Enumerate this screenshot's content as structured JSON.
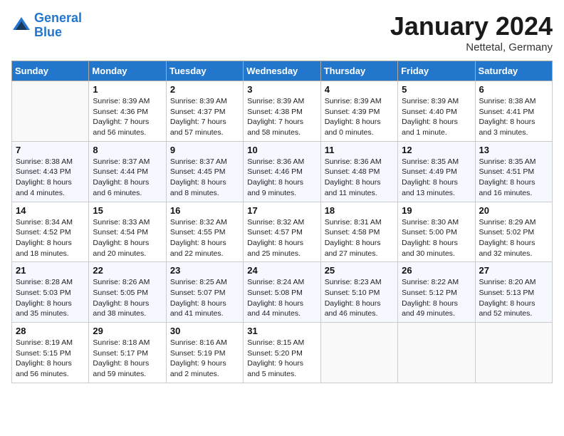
{
  "header": {
    "logo_line1": "General",
    "logo_line2": "Blue",
    "month_title": "January 2024",
    "subtitle": "Nettetal, Germany"
  },
  "weekdays": [
    "Sunday",
    "Monday",
    "Tuesday",
    "Wednesday",
    "Thursday",
    "Friday",
    "Saturday"
  ],
  "weeks": [
    {
      "days": [
        {
          "num": "",
          "info": ""
        },
        {
          "num": "1",
          "info": "Sunrise: 8:39 AM\nSunset: 4:36 PM\nDaylight: 7 hours\nand 56 minutes."
        },
        {
          "num": "2",
          "info": "Sunrise: 8:39 AM\nSunset: 4:37 PM\nDaylight: 7 hours\nand 57 minutes."
        },
        {
          "num": "3",
          "info": "Sunrise: 8:39 AM\nSunset: 4:38 PM\nDaylight: 7 hours\nand 58 minutes."
        },
        {
          "num": "4",
          "info": "Sunrise: 8:39 AM\nSunset: 4:39 PM\nDaylight: 8 hours\nand 0 minutes."
        },
        {
          "num": "5",
          "info": "Sunrise: 8:39 AM\nSunset: 4:40 PM\nDaylight: 8 hours\nand 1 minute."
        },
        {
          "num": "6",
          "info": "Sunrise: 8:38 AM\nSunset: 4:41 PM\nDaylight: 8 hours\nand 3 minutes."
        }
      ]
    },
    {
      "days": [
        {
          "num": "7",
          "info": "Sunrise: 8:38 AM\nSunset: 4:43 PM\nDaylight: 8 hours\nand 4 minutes."
        },
        {
          "num": "8",
          "info": "Sunrise: 8:37 AM\nSunset: 4:44 PM\nDaylight: 8 hours\nand 6 minutes."
        },
        {
          "num": "9",
          "info": "Sunrise: 8:37 AM\nSunset: 4:45 PM\nDaylight: 8 hours\nand 8 minutes."
        },
        {
          "num": "10",
          "info": "Sunrise: 8:36 AM\nSunset: 4:46 PM\nDaylight: 8 hours\nand 9 minutes."
        },
        {
          "num": "11",
          "info": "Sunrise: 8:36 AM\nSunset: 4:48 PM\nDaylight: 8 hours\nand 11 minutes."
        },
        {
          "num": "12",
          "info": "Sunrise: 8:35 AM\nSunset: 4:49 PM\nDaylight: 8 hours\nand 13 minutes."
        },
        {
          "num": "13",
          "info": "Sunrise: 8:35 AM\nSunset: 4:51 PM\nDaylight: 8 hours\nand 16 minutes."
        }
      ]
    },
    {
      "days": [
        {
          "num": "14",
          "info": "Sunrise: 8:34 AM\nSunset: 4:52 PM\nDaylight: 8 hours\nand 18 minutes."
        },
        {
          "num": "15",
          "info": "Sunrise: 8:33 AM\nSunset: 4:54 PM\nDaylight: 8 hours\nand 20 minutes."
        },
        {
          "num": "16",
          "info": "Sunrise: 8:32 AM\nSunset: 4:55 PM\nDaylight: 8 hours\nand 22 minutes."
        },
        {
          "num": "17",
          "info": "Sunrise: 8:32 AM\nSunset: 4:57 PM\nDaylight: 8 hours\nand 25 minutes."
        },
        {
          "num": "18",
          "info": "Sunrise: 8:31 AM\nSunset: 4:58 PM\nDaylight: 8 hours\nand 27 minutes."
        },
        {
          "num": "19",
          "info": "Sunrise: 8:30 AM\nSunset: 5:00 PM\nDaylight: 8 hours\nand 30 minutes."
        },
        {
          "num": "20",
          "info": "Sunrise: 8:29 AM\nSunset: 5:02 PM\nDaylight: 8 hours\nand 32 minutes."
        }
      ]
    },
    {
      "days": [
        {
          "num": "21",
          "info": "Sunrise: 8:28 AM\nSunset: 5:03 PM\nDaylight: 8 hours\nand 35 minutes."
        },
        {
          "num": "22",
          "info": "Sunrise: 8:26 AM\nSunset: 5:05 PM\nDaylight: 8 hours\nand 38 minutes."
        },
        {
          "num": "23",
          "info": "Sunrise: 8:25 AM\nSunset: 5:07 PM\nDaylight: 8 hours\nand 41 minutes."
        },
        {
          "num": "24",
          "info": "Sunrise: 8:24 AM\nSunset: 5:08 PM\nDaylight: 8 hours\nand 44 minutes."
        },
        {
          "num": "25",
          "info": "Sunrise: 8:23 AM\nSunset: 5:10 PM\nDaylight: 8 hours\nand 46 minutes."
        },
        {
          "num": "26",
          "info": "Sunrise: 8:22 AM\nSunset: 5:12 PM\nDaylight: 8 hours\nand 49 minutes."
        },
        {
          "num": "27",
          "info": "Sunrise: 8:20 AM\nSunset: 5:13 PM\nDaylight: 8 hours\nand 52 minutes."
        }
      ]
    },
    {
      "days": [
        {
          "num": "28",
          "info": "Sunrise: 8:19 AM\nSunset: 5:15 PM\nDaylight: 8 hours\nand 56 minutes."
        },
        {
          "num": "29",
          "info": "Sunrise: 8:18 AM\nSunset: 5:17 PM\nDaylight: 8 hours\nand 59 minutes."
        },
        {
          "num": "30",
          "info": "Sunrise: 8:16 AM\nSunset: 5:19 PM\nDaylight: 9 hours\nand 2 minutes."
        },
        {
          "num": "31",
          "info": "Sunrise: 8:15 AM\nSunset: 5:20 PM\nDaylight: 9 hours\nand 5 minutes."
        },
        {
          "num": "",
          "info": ""
        },
        {
          "num": "",
          "info": ""
        },
        {
          "num": "",
          "info": ""
        }
      ]
    }
  ]
}
